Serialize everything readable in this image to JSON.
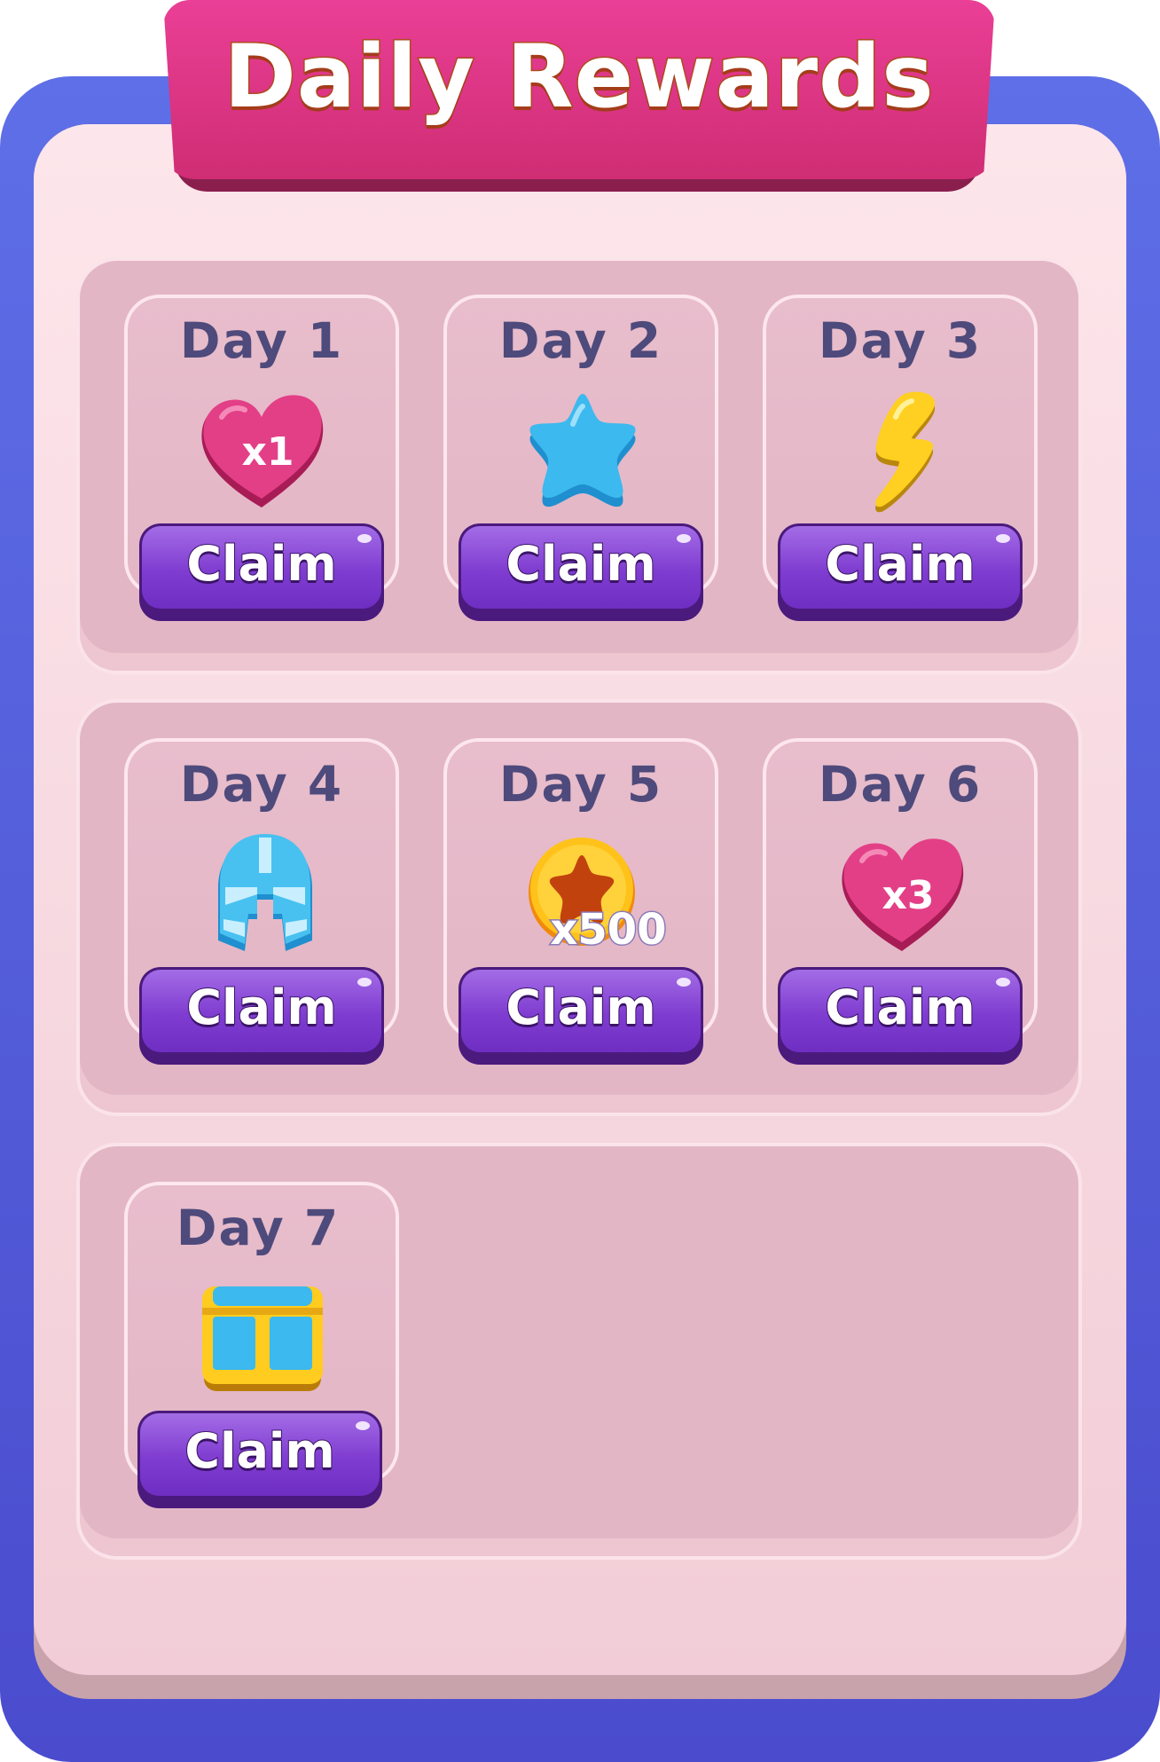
{
  "title": "Daily Rewards",
  "claim_label": "Claim",
  "days": [
    {
      "label": "Day 1",
      "reward": "heart-icon",
      "qty": "x1"
    },
    {
      "label": "Day 2",
      "reward": "star-icon",
      "qty": ""
    },
    {
      "label": "Day 3",
      "reward": "lightning-bolt-icon",
      "qty": ""
    },
    {
      "label": "Day 4",
      "reward": "helmet-icon",
      "qty": ""
    },
    {
      "label": "Day 5",
      "reward": "coin-icon",
      "qty": "x500"
    },
    {
      "label": "Day 6",
      "reward": "heart-icon",
      "qty": "x3"
    },
    {
      "label": "Day 7",
      "reward": "treasure-chest-icon",
      "qty": ""
    }
  ],
  "colors": {
    "frame": "#5865e0",
    "banner": "#e03a8a",
    "button": "#8a46d6",
    "day_text": "#4e4a7b"
  }
}
